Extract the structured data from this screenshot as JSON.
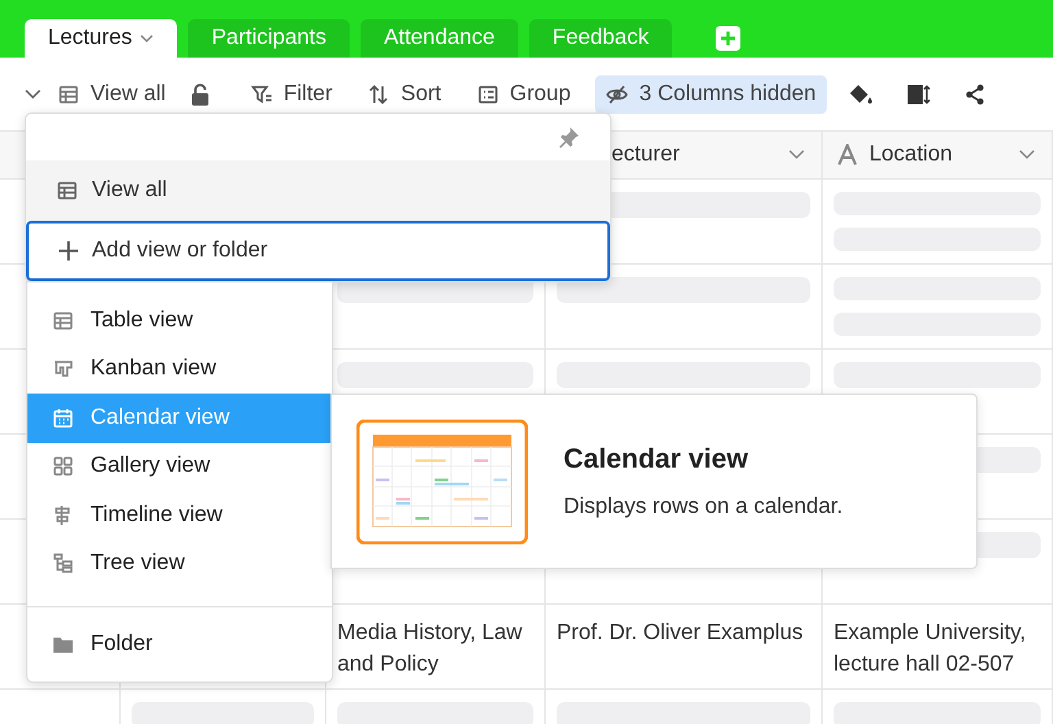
{
  "tabs": [
    {
      "label": "Lectures",
      "selected": true
    },
    {
      "label": "Participants",
      "selected": false
    },
    {
      "label": "Attendance",
      "selected": false
    },
    {
      "label": "Feedback",
      "selected": false
    }
  ],
  "toolbar": {
    "view_label": "View all",
    "items": [
      {
        "kind": "filter",
        "label": "Filter",
        "active": false
      },
      {
        "kind": "sort",
        "label": "Sort",
        "active": false
      },
      {
        "kind": "group",
        "label": "Group",
        "active": false
      },
      {
        "kind": "hidden",
        "label": "3 Columns hidden",
        "active": true
      }
    ]
  },
  "table": {
    "columns": [
      {
        "label": "ecturer",
        "show_icon": false
      },
      {
        "label": "Location",
        "show_icon": true
      }
    ],
    "rows": [
      {
        "kind": "loading"
      },
      {
        "kind": "loading"
      },
      {
        "kind": "loading"
      },
      {
        "kind": "loading"
      },
      {
        "kind": "loading"
      },
      {
        "kind": "data",
        "cells": [
          "Media History, Law and Policy",
          "Prof. Dr. Oliver Examplus",
          "Example University, lecture hall 02-507"
        ]
      },
      {
        "kind": "loading"
      }
    ]
  },
  "view_menu": {
    "current_view": "View all",
    "add_label": "Add view or folder",
    "add_focused": true,
    "view_types": [
      {
        "kind": "table",
        "label": "Table view",
        "selected": false
      },
      {
        "kind": "kanban",
        "label": "Kanban view",
        "selected": false
      },
      {
        "kind": "calendar",
        "label": "Calendar view",
        "selected": true
      },
      {
        "kind": "gallery",
        "label": "Gallery view",
        "selected": false
      },
      {
        "kind": "timeline",
        "label": "Timeline view",
        "selected": false
      },
      {
        "kind": "tree",
        "label": "Tree view",
        "selected": false
      }
    ],
    "folder_label": "Folder",
    "preview": {
      "title": "Calendar view",
      "description": "Displays rows on a calendar."
    }
  }
}
